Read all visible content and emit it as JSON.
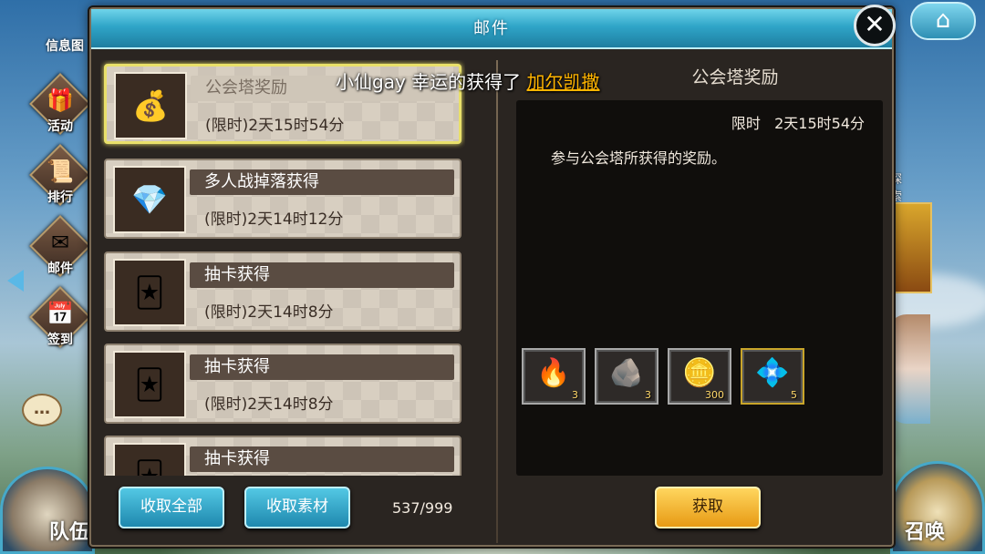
{
  "game_ui": {
    "left_rail": {
      "info_label": "信息图",
      "buttons": [
        {
          "icon": "activity-icon",
          "label": "活动"
        },
        {
          "icon": "ranking-icon",
          "label": "排行"
        },
        {
          "icon": "mail-icon",
          "label": "邮件"
        },
        {
          "icon": "checkin-icon",
          "label": "签到"
        }
      ],
      "chat_label": "…",
      "team_label": "队伍"
    },
    "right_rail": {
      "side_text": "探索",
      "summon_label": "召唤"
    }
  },
  "dialog": {
    "title": "邮件",
    "close_label": "✕",
    "mail_list": [
      {
        "subject": "公会塔奖励",
        "time": "(限时)2天15时54分",
        "icon": "treasure-chest-icon",
        "selected": true
      },
      {
        "subject": "多人战掉落获得",
        "time": "(限时)2天14时12分",
        "icon": "crystal-chest-icon",
        "selected": false
      },
      {
        "subject": "抽卡获得",
        "time": "(限时)2天14时8分",
        "icon": "cards-icon",
        "selected": false
      },
      {
        "subject": "抽卡获得",
        "time": "(限时)2天14时8分",
        "icon": "cards-icon",
        "selected": false
      },
      {
        "subject": "抽卡获得",
        "time": "",
        "icon": "cards-icon",
        "selected": false
      }
    ],
    "detail": {
      "title": "公会塔奖励",
      "limit_label": "限时",
      "limit_value": "2天15时54分",
      "description": "参与公会塔所获得的奖励。",
      "rewards": [
        {
          "icon": "fire-essence-icon",
          "count": "3"
        },
        {
          "icon": "ore-chunk-icon",
          "count": "3"
        },
        {
          "icon": "gold-coins-icon",
          "count": "300"
        },
        {
          "icon": "green-crystal-icon",
          "count": "5"
        }
      ]
    },
    "buttons": {
      "collect_all": "收取全部",
      "collect_materials": "收取素材",
      "claim": "获取"
    },
    "mail_count": "537/999"
  },
  "notice": {
    "prefix": "小仙gay 幸运的获得了 ",
    "highlight": "加尔凯撒"
  },
  "colors": {
    "title_bar": "#2fa5c8",
    "selected_border": "#e9e06a",
    "claim_button": "#e79a14",
    "highlight_text": "#ffb400"
  }
}
